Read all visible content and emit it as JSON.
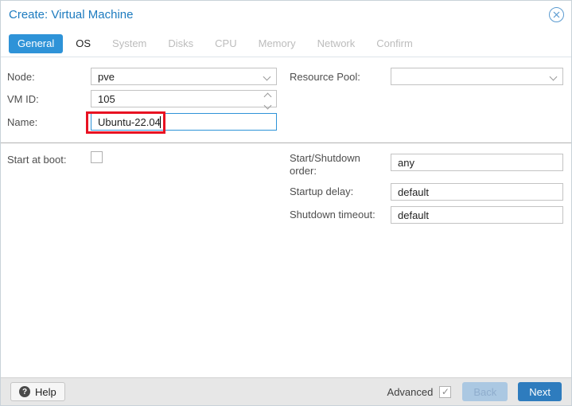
{
  "window": {
    "title": "Create: Virtual Machine"
  },
  "tabs": [
    {
      "label": "General",
      "state": "active"
    },
    {
      "label": "OS",
      "state": "enabled"
    },
    {
      "label": "System",
      "state": "disabled"
    },
    {
      "label": "Disks",
      "state": "disabled"
    },
    {
      "label": "CPU",
      "state": "disabled"
    },
    {
      "label": "Memory",
      "state": "disabled"
    },
    {
      "label": "Network",
      "state": "disabled"
    },
    {
      "label": "Confirm",
      "state": "disabled"
    }
  ],
  "form": {
    "node": {
      "label": "Node:",
      "value": "pve",
      "control": "combobox"
    },
    "vm_id": {
      "label": "VM ID:",
      "value": "105",
      "control": "spinner"
    },
    "name": {
      "label": "Name:",
      "value": "Ubuntu-22.04",
      "control": "text",
      "focused": true,
      "highlighted_by_red_annotation": true
    },
    "resource_pool": {
      "label": "Resource Pool:",
      "value": "",
      "control": "combobox"
    },
    "start_at_boot": {
      "label": "Start at boot:",
      "checked": false
    },
    "startup_order": {
      "label": "Start/Shutdown order:",
      "value": "any"
    },
    "startup_delay": {
      "label": "Startup delay:",
      "value": "default"
    },
    "shutdown_timeout": {
      "label": "Shutdown timeout:",
      "value": "default"
    }
  },
  "footer": {
    "help_label": "Help",
    "advanced_label": "Advanced",
    "advanced_checked": true,
    "back_label": "Back",
    "next_label": "Next"
  },
  "icons": {
    "close": "circle-x",
    "help": "question-mark-circle",
    "help_glyph": "?",
    "check_glyph": "✓",
    "node_dropdown": "chevron-down",
    "resource_pool_dropdown": "chevron-down",
    "vm_id_spinner": "up-down-chevrons"
  },
  "colors": {
    "title_blue": "#1d7bbf",
    "active_tab_blue": "#2e93d8",
    "next_button_blue": "#2e7cbe",
    "back_button_bg": "#abc8e2",
    "annotation_red": "#e81222",
    "focused_input_border": "#2e93d8",
    "footer_bg": "#e7e7e7",
    "divider_gray": "#b2b2b2"
  }
}
